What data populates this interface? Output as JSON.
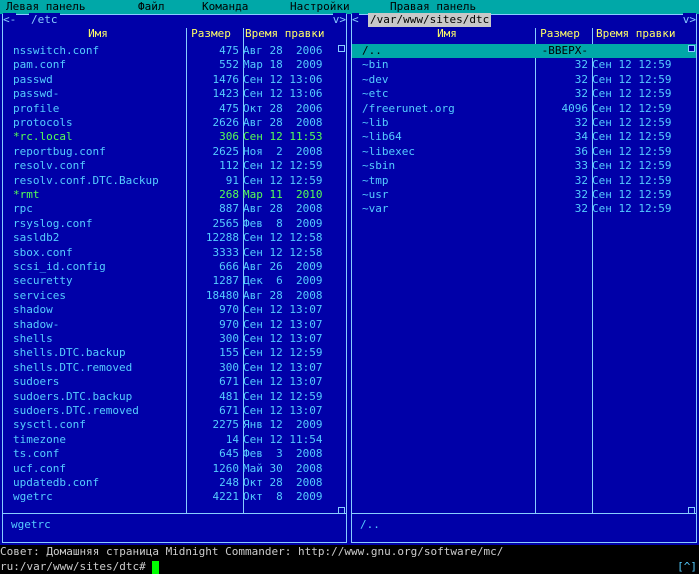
{
  "menu": [
    "Левая панель",
    "Файл",
    "Команда",
    "Настройки",
    "Правая панель"
  ],
  "left_panel": {
    "path": "/etc",
    "corner_left": "<-",
    "corner_right": "v>",
    "columns": {
      "name": "Имя",
      "size": "Размер",
      "date": "Время правки"
    },
    "files": [
      {
        "name": "nsswitch.conf",
        "size": "475",
        "date": "Авг 28  2006",
        "exec": false
      },
      {
        "name": "pam.conf",
        "size": "552",
        "date": "Мар 18  2009",
        "exec": false
      },
      {
        "name": "passwd",
        "size": "1476",
        "date": "Сен 12 13:06",
        "exec": false
      },
      {
        "name": "passwd-",
        "size": "1423",
        "date": "Сен 12 13:06",
        "exec": false
      },
      {
        "name": "profile",
        "size": "475",
        "date": "Окт 28  2006",
        "exec": false
      },
      {
        "name": "protocols",
        "size": "2626",
        "date": "Авг 28  2008",
        "exec": false
      },
      {
        "name": "*rc.local",
        "size": "306",
        "date": "Сен 12 11:53",
        "exec": true
      },
      {
        "name": "reportbug.conf",
        "size": "2625",
        "date": "Ноя  2  2008",
        "exec": false
      },
      {
        "name": "resolv.conf",
        "size": "112",
        "date": "Сен 12 12:59",
        "exec": false
      },
      {
        "name": "resolv.conf.DTC.Backup",
        "size": "91",
        "date": "Сен 12 12:59",
        "exec": false
      },
      {
        "name": "*rmt",
        "size": "268",
        "date": "Мар 11  2010",
        "exec": true
      },
      {
        "name": "rpc",
        "size": "887",
        "date": "Авг 28  2008",
        "exec": false
      },
      {
        "name": "rsyslog.conf",
        "size": "2565",
        "date": "Фев  8  2009",
        "exec": false
      },
      {
        "name": "sasldb2",
        "size": "12288",
        "date": "Сен 12 12:58",
        "exec": false
      },
      {
        "name": "sbox.conf",
        "size": "3333",
        "date": "Сен 12 12:58",
        "exec": false
      },
      {
        "name": "scsi_id.config",
        "size": "666",
        "date": "Авг 26  2009",
        "exec": false
      },
      {
        "name": "securetty",
        "size": "1287",
        "date": "Дек  6  2009",
        "exec": false
      },
      {
        "name": "services",
        "size": "18480",
        "date": "Авг 28  2008",
        "exec": false
      },
      {
        "name": "shadow",
        "size": "970",
        "date": "Сен 12 13:07",
        "exec": false
      },
      {
        "name": "shadow-",
        "size": "970",
        "date": "Сен 12 13:07",
        "exec": false
      },
      {
        "name": "shells",
        "size": "300",
        "date": "Сен 12 13:07",
        "exec": false
      },
      {
        "name": "shells.DTC.backup",
        "size": "155",
        "date": "Сен 12 12:59",
        "exec": false
      },
      {
        "name": "shells.DTC.removed",
        "size": "300",
        "date": "Сен 12 13:07",
        "exec": false
      },
      {
        "name": "sudoers",
        "size": "671",
        "date": "Сен 12 13:07",
        "exec": false
      },
      {
        "name": "sudoers.DTC.backup",
        "size": "481",
        "date": "Сен 12 12:59",
        "exec": false
      },
      {
        "name": "sudoers.DTC.removed",
        "size": "671",
        "date": "Сен 12 13:07",
        "exec": false
      },
      {
        "name": "sysctl.conf",
        "size": "2275",
        "date": "Янв 12  2009",
        "exec": false
      },
      {
        "name": "timezone",
        "size": "14",
        "date": "Сен 12 11:54",
        "exec": false
      },
      {
        "name": "ts.conf",
        "size": "645",
        "date": "Фев  3  2008",
        "exec": false
      },
      {
        "name": "ucf.conf",
        "size": "1260",
        "date": "Май 30  2008",
        "exec": false
      },
      {
        "name": "updatedb.conf",
        "size": "248",
        "date": "Окт 28  2008",
        "exec": false
      },
      {
        "name": "wgetrc",
        "size": "4221",
        "date": "Окт  8  2009",
        "exec": false
      }
    ],
    "mini_status": "wgetrc"
  },
  "right_panel": {
    "path": "/var/www/sites/dtc",
    "corner_left": "<",
    "corner_right": "v>",
    "columns": {
      "name": "Имя",
      "size": "Размер",
      "date": "Время правки"
    },
    "files": [
      {
        "name": "/..",
        "size": "-ВВЕРХ-",
        "date": "",
        "selected": true
      },
      {
        "name": "~bin",
        "size": "32",
        "date": "Сен 12 12:59",
        "selected": false
      },
      {
        "name": "~dev",
        "size": "32",
        "date": "Сен 12 12:59",
        "selected": false
      },
      {
        "name": "~etc",
        "size": "32",
        "date": "Сен 12 12:59",
        "selected": false
      },
      {
        "name": "/freerunet.org",
        "size": "4096",
        "date": "Сен 12 12:59",
        "selected": false
      },
      {
        "name": "~lib",
        "size": "32",
        "date": "Сен 12 12:59",
        "selected": false
      },
      {
        "name": "~lib64",
        "size": "34",
        "date": "Сен 12 12:59",
        "selected": false
      },
      {
        "name": "~libexec",
        "size": "36",
        "date": "Сен 12 12:59",
        "selected": false
      },
      {
        "name": "~sbin",
        "size": "33",
        "date": "Сен 12 12:59",
        "selected": false
      },
      {
        "name": "~tmp",
        "size": "32",
        "date": "Сен 12 12:59",
        "selected": false
      },
      {
        "name": "~usr",
        "size": "32",
        "date": "Сен 12 12:59",
        "selected": false
      },
      {
        "name": "~var",
        "size": "32",
        "date": "Сен 12 12:59",
        "selected": false
      }
    ],
    "mini_status": "/.."
  },
  "hint": "Совет: Домашняя страница Midnight Commander: http://www.gnu.org/software/mc/",
  "command": {
    "prompt": "ru:/var/www/sites/dtc# ",
    "tag": "[^]"
  },
  "colors": {
    "background": "#0000a8",
    "menubar": "#00a8a8",
    "selection": "#00a8a8",
    "header": "#ffff66",
    "executable": "#55ff55"
  }
}
